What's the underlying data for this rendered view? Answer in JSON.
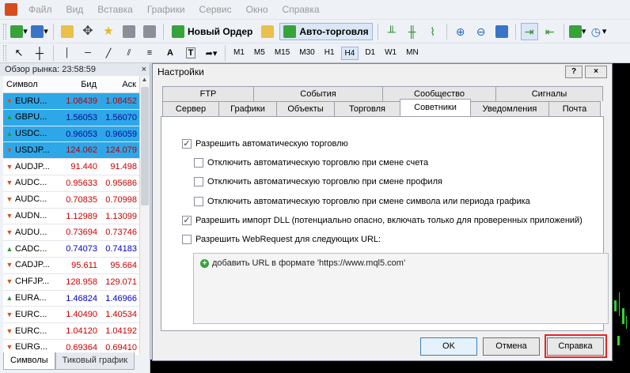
{
  "menu": [
    "Файл",
    "Вид",
    "Вставка",
    "Графики",
    "Сервис",
    "Окно",
    "Справка"
  ],
  "toolbar": {
    "new_order": "Новый Ордер",
    "auto_trading": "Авто-торговля",
    "timeframes": [
      "M1",
      "M5",
      "M15",
      "M30",
      "H1",
      "H4",
      "D1",
      "W1",
      "MN"
    ],
    "active_timeframe": "H4",
    "text_tool": "A",
    "text_tool2": "T"
  },
  "market_watch": {
    "title": "Обзор рынка: 23:58:59",
    "close": "×",
    "headers": {
      "symbol": "Символ",
      "bid": "Бид",
      "ask": "Аск"
    },
    "rows": [
      {
        "symbol": "EURU...",
        "bid": "1.08439",
        "ask": "1.08452",
        "dir": "down",
        "bid_color": "red",
        "ask_color": "red",
        "selected": true
      },
      {
        "symbol": "GBPU...",
        "bid": "1.56053",
        "ask": "1.56070",
        "dir": "up",
        "bid_color": "blue",
        "ask_color": "blue",
        "selected": true
      },
      {
        "symbol": "USDC...",
        "bid": "0.96053",
        "ask": "0.96059",
        "dir": "up",
        "bid_color": "blue",
        "ask_color": "blue",
        "selected": true
      },
      {
        "symbol": "USDJP...",
        "bid": "124.062",
        "ask": "124.079",
        "dir": "down",
        "bid_color": "red",
        "ask_color": "red",
        "selected": true
      },
      {
        "symbol": "AUDJP...",
        "bid": "91.440",
        "ask": "91.498",
        "dir": "down",
        "bid_color": "red",
        "ask_color": "red",
        "selected": false
      },
      {
        "symbol": "AUDC...",
        "bid": "0.95633",
        "ask": "0.95686",
        "dir": "down",
        "bid_color": "red",
        "ask_color": "red",
        "selected": false
      },
      {
        "symbol": "AUDC...",
        "bid": "0.70835",
        "ask": "0.70998",
        "dir": "down",
        "bid_color": "red",
        "ask_color": "red",
        "selected": false
      },
      {
        "symbol": "AUDN...",
        "bid": "1.12989",
        "ask": "1.13099",
        "dir": "down",
        "bid_color": "red",
        "ask_color": "red",
        "selected": false
      },
      {
        "symbol": "AUDU...",
        "bid": "0.73694",
        "ask": "0.73746",
        "dir": "down",
        "bid_color": "red",
        "ask_color": "red",
        "selected": false
      },
      {
        "symbol": "CADC...",
        "bid": "0.74073",
        "ask": "0.74183",
        "dir": "up",
        "bid_color": "blue",
        "ask_color": "blue",
        "selected": false
      },
      {
        "symbol": "CADJP...",
        "bid": "95.611",
        "ask": "95.664",
        "dir": "down",
        "bid_color": "red",
        "ask_color": "red",
        "selected": false
      },
      {
        "symbol": "CHFJP...",
        "bid": "128.958",
        "ask": "129.071",
        "dir": "down",
        "bid_color": "red",
        "ask_color": "red",
        "selected": false
      },
      {
        "symbol": "EURA...",
        "bid": "1.46824",
        "ask": "1.46966",
        "dir": "up",
        "bid_color": "blue",
        "ask_color": "blue",
        "selected": false
      },
      {
        "symbol": "EURC...",
        "bid": "1.40490",
        "ask": "1.40534",
        "dir": "down",
        "bid_color": "red",
        "ask_color": "red",
        "selected": false
      },
      {
        "symbol": "EURC...",
        "bid": "1.04120",
        "ask": "1.04192",
        "dir": "down",
        "bid_color": "red",
        "ask_color": "red",
        "selected": false
      },
      {
        "symbol": "EURG...",
        "bid": "0.69364",
        "ask": "0.69410",
        "dir": "down",
        "bid_color": "red",
        "ask_color": "red",
        "selected": false
      }
    ],
    "tabs": [
      "Символы",
      "Тиковый график"
    ]
  },
  "dialog": {
    "title": "Настройки",
    "help_btn": "?",
    "close_btn": "×",
    "tabs_row1": [
      "FTP",
      "События",
      "Сообщество",
      "Сигналы"
    ],
    "tabs_row2": [
      "Сервер",
      "Графики",
      "Объекты",
      "Торговля",
      "Советники",
      "Уведомления",
      "Почта"
    ],
    "active_tab": "Советники",
    "options": [
      {
        "label": "Разрешить автоматическую торговлю",
        "checked": true
      },
      {
        "label": "Отключить автоматическую торговлю при смене счета",
        "checked": false
      },
      {
        "label": "Отключить автоматическую торговлю при смене профиля",
        "checked": false
      },
      {
        "label": "Отключить автоматическую торговлю при смене символа или периода графика",
        "checked": false
      },
      {
        "label": "Разрешить импорт DLL (потенциально опасно, включать только для проверенных приложений)",
        "checked": true
      },
      {
        "label": "Разрешить WebRequest для следующих URL:",
        "checked": false
      }
    ],
    "url_add": "добавить URL в формате 'https://www.mql5.com'",
    "buttons": {
      "ok": "OK",
      "cancel": "Отмена",
      "help": "Справка"
    }
  }
}
